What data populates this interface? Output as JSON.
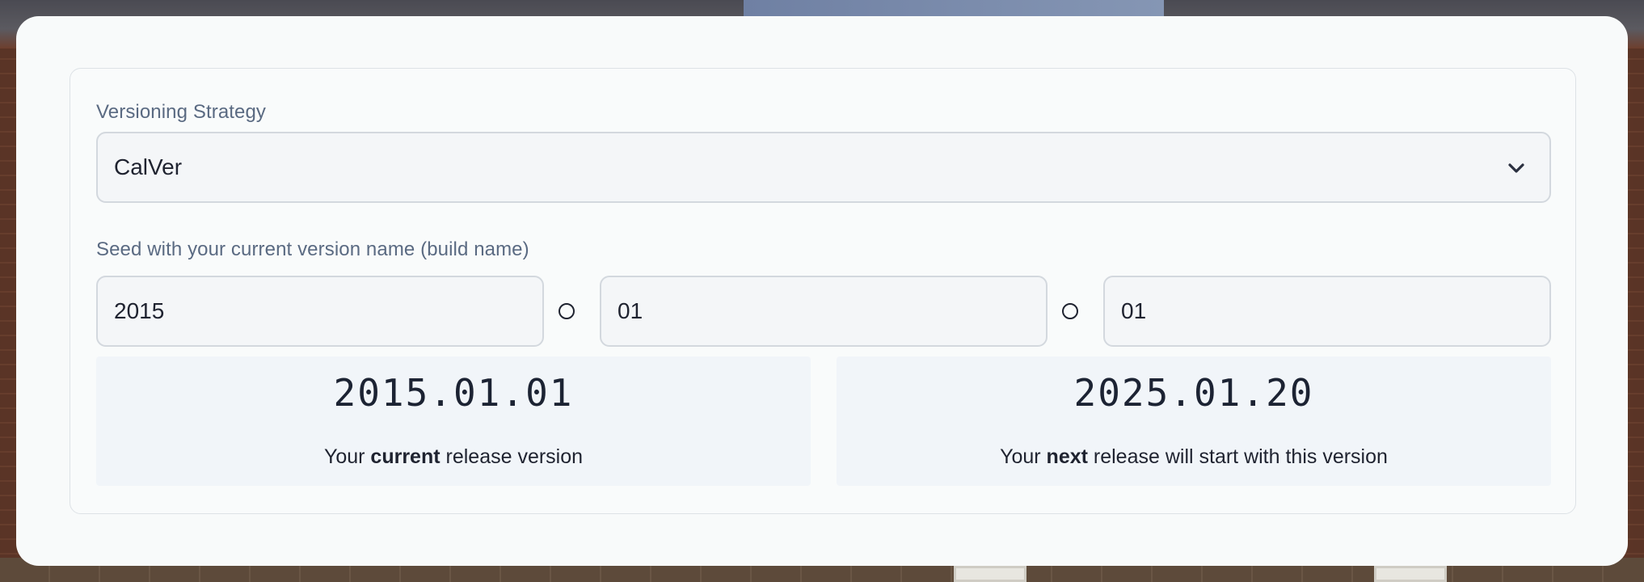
{
  "strategy": {
    "label": "Versioning Strategy",
    "selected": "CalVer",
    "icon": "chevron-down-icon"
  },
  "seed": {
    "label": "Seed with your current version name (build name)",
    "year": "2015",
    "month": "01",
    "day": "01",
    "separator_icon": "circle-icon"
  },
  "current": {
    "version": "2015.01.01",
    "caption_pre": "Your ",
    "caption_bold": "current",
    "caption_post": " release version"
  },
  "next": {
    "version": "2025.01.20",
    "caption_pre": "Your ",
    "caption_bold": "next",
    "caption_post": " release will start with this version"
  }
}
